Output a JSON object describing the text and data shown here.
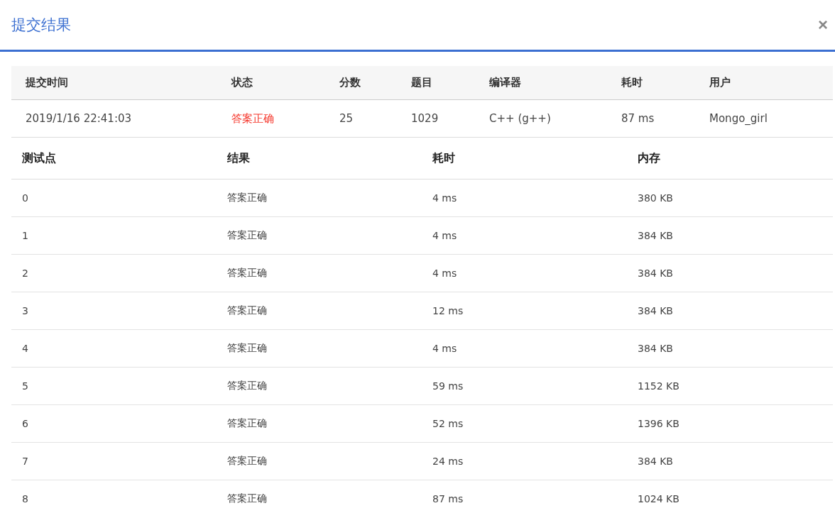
{
  "dialog": {
    "title": "提交结果",
    "close": "×"
  },
  "submission": {
    "columns": [
      "提交时间",
      "状态",
      "分数",
      "题目",
      "编译器",
      "耗时",
      "用户"
    ],
    "row": [
      "2019/1/16 22:41:03",
      "答案正确",
      "25",
      "1029",
      "C++ (g++)",
      "87 ms",
      "Mongo_girl"
    ]
  },
  "tests": {
    "columns": [
      "测试点",
      "结果",
      "耗时",
      "内存"
    ],
    "rows": [
      [
        "0",
        "答案正确",
        "4 ms",
        "380 KB"
      ],
      [
        "1",
        "答案正确",
        "4 ms",
        "384 KB"
      ],
      [
        "2",
        "答案正确",
        "4 ms",
        "384 KB"
      ],
      [
        "3",
        "答案正确",
        "12 ms",
        "384 KB"
      ],
      [
        "4",
        "答案正确",
        "4 ms",
        "384 KB"
      ],
      [
        "5",
        "答案正确",
        "59 ms",
        "1152 KB"
      ],
      [
        "6",
        "答案正确",
        "52 ms",
        "1396 KB"
      ],
      [
        "7",
        "答案正确",
        "24 ms",
        "384 KB"
      ],
      [
        "8",
        "答案正确",
        "87 ms",
        "1024 KB"
      ]
    ]
  }
}
